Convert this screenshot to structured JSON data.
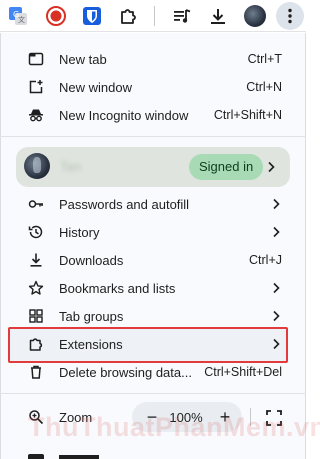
{
  "toolbar": {
    "icons": [
      "translate-extension-icon",
      "record-extension-icon",
      "bitwarden-icon",
      "extensions-puzzle-icon",
      "media-queue-icon",
      "download-icon",
      "profile-avatar",
      "more-menu-icon"
    ]
  },
  "menu": {
    "new_tab": {
      "label": "New tab",
      "shortcut": "Ctrl+T"
    },
    "new_window": {
      "label": "New window",
      "shortcut": "Ctrl+N"
    },
    "incognito": {
      "label": "New Incognito window",
      "shortcut": "Ctrl+Shift+N"
    },
    "profile": {
      "name": "Tan",
      "status": "Signed in"
    },
    "passwords": {
      "label": "Passwords and autofill"
    },
    "history": {
      "label": "History"
    },
    "downloads": {
      "label": "Downloads",
      "shortcut": "Ctrl+J"
    },
    "bookmarks": {
      "label": "Bookmarks and lists"
    },
    "tab_groups": {
      "label": "Tab groups"
    },
    "extensions": {
      "label": "Extensions"
    },
    "delete_browsing": {
      "label": "Delete browsing data...",
      "shortcut": "Ctrl+Shift+Del"
    },
    "zoom": {
      "label": "Zoom",
      "minus": "−",
      "value": "100%",
      "plus": "+"
    }
  },
  "watermark": "ThuThuatPhanMem.vn",
  "colors": {
    "highlight_border": "#e23b3b",
    "signed_in_chip": "#a8dab5",
    "profile_bg": "#dfe5de",
    "menu_bg": "#f8fafd"
  }
}
